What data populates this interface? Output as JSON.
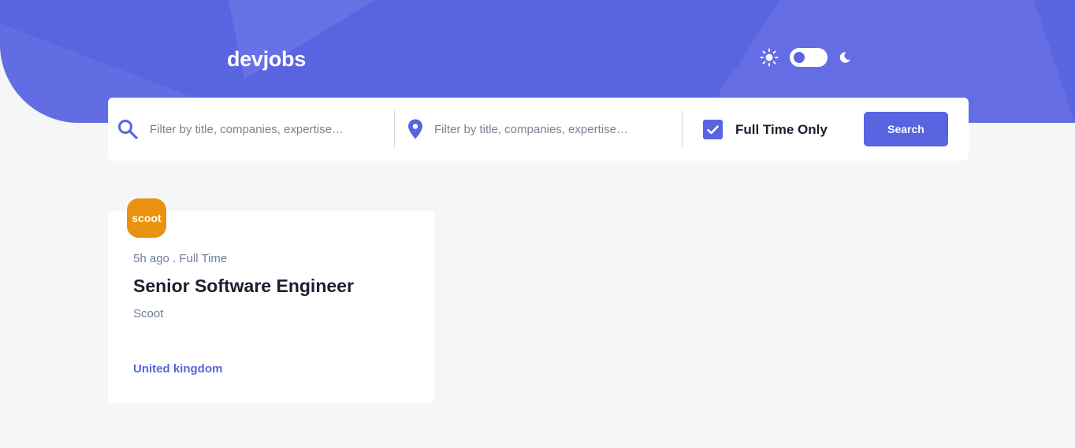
{
  "colors": {
    "accent": "#5964e0",
    "background": "#f4f6f8",
    "company_logo": "#e99210",
    "text_dark": "#19202d",
    "text_muted": "#6e8098"
  },
  "header": {
    "logo": "devjobs",
    "theme": {
      "light_icon": "sun-icon",
      "dark_icon": "moon-icon",
      "toggle_state": "light"
    }
  },
  "search": {
    "title_filter": {
      "icon": "search-icon",
      "placeholder": "Filter by title, companies, expertise…",
      "value": ""
    },
    "location_filter": {
      "icon": "location-pin-icon",
      "placeholder": "Filter by title, companies, expertise…",
      "value": ""
    },
    "full_time": {
      "label": "Full Time Only",
      "checked": true
    },
    "button_label": "Search"
  },
  "jobs": [
    {
      "logo_text": "scoot",
      "posted": "5h ago",
      "separator": " . ",
      "contract": "Full Time",
      "position": "Senior Software Engineer",
      "company": "Scoot",
      "location": "United kingdom"
    }
  ]
}
